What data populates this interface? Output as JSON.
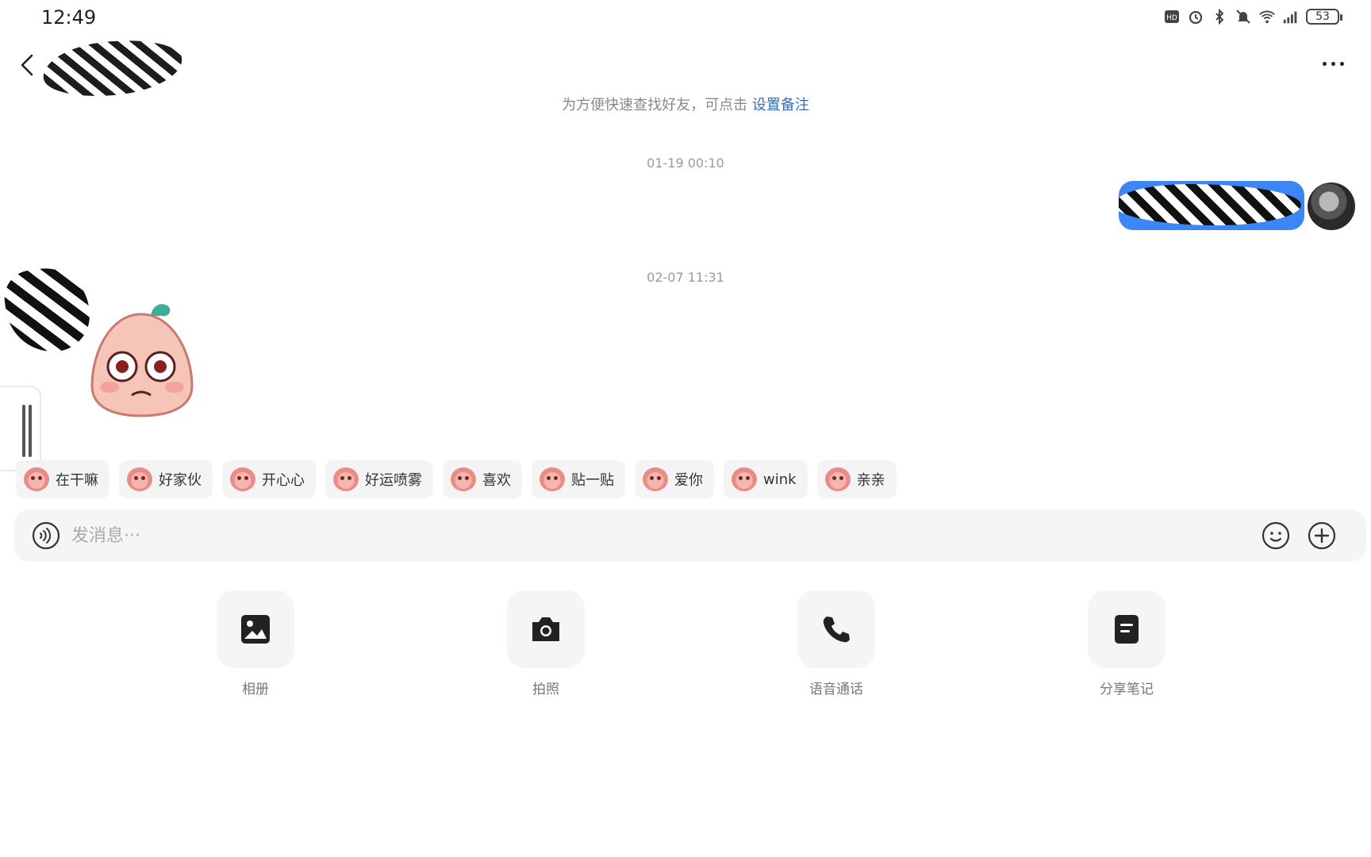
{
  "status_bar": {
    "time": "12:49",
    "battery": "53",
    "icons": [
      "hd-icon",
      "alarm-icon",
      "bluetooth-icon",
      "mute-icon",
      "wifi-icon",
      "signal-icon",
      "battery-icon"
    ]
  },
  "header": {
    "back_icon": "chevron-left-icon",
    "more_icon": "more-dots-icon"
  },
  "tip": {
    "text": "为方便快速查找好友，可点击 ",
    "link": "设置备注"
  },
  "messages": {
    "timestamp_1": "01-19 00:10",
    "timestamp_2": "02-07 11:31"
  },
  "quick_replies": [
    "在干嘛",
    "好家伙",
    "开心心",
    "好运喷雾",
    "喜欢",
    "贴一贴",
    "爱你",
    "wink",
    "亲亲"
  ],
  "input": {
    "placeholder": "发消息···",
    "value": ""
  },
  "actions": {
    "album": "相册",
    "camera": "拍照",
    "voice_call": "语音通话",
    "share_note": "分享笔记"
  },
  "colors": {
    "accent": "#3a6bb3",
    "bubble": "#3d86f5"
  }
}
